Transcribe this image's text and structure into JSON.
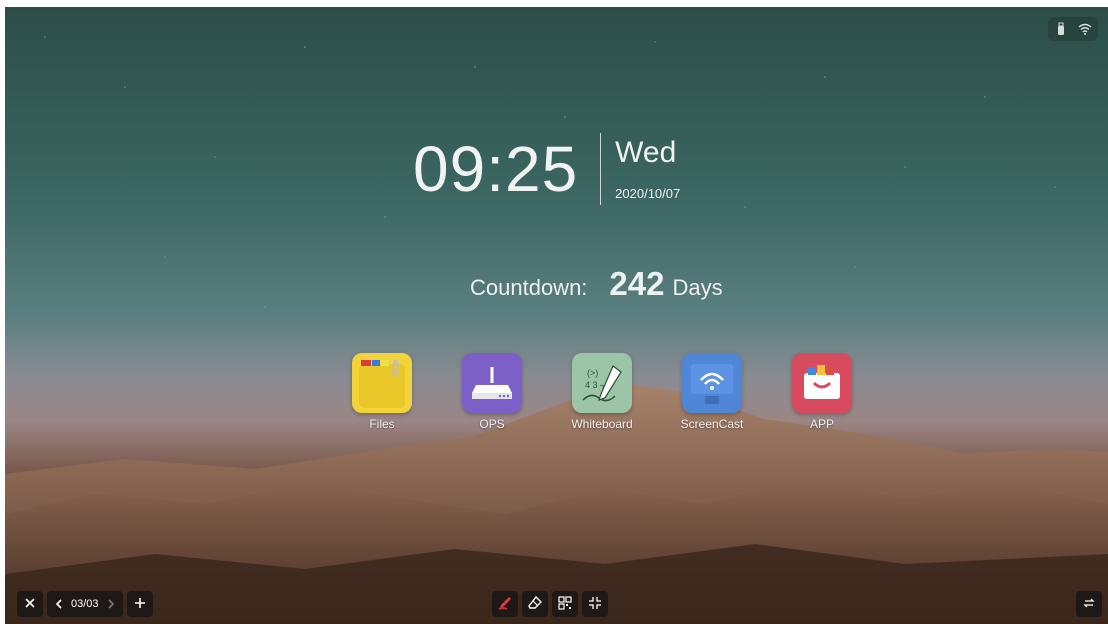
{
  "status_bar": {
    "icons": [
      "usb-icon",
      "wifi-icon"
    ]
  },
  "clock": {
    "time": "09:25",
    "day": "Wed",
    "date": "2020/10/07"
  },
  "countdown": {
    "label": "Countdown:",
    "value": "242",
    "unit": "Days"
  },
  "apps": [
    {
      "label": "Files",
      "icon": "folder-icon",
      "color": "#f2d43a"
    },
    {
      "label": "OPS",
      "icon": "router-icon",
      "color": "#7d5fc8"
    },
    {
      "label": "Whiteboard",
      "icon": "pen-board-icon",
      "color": "#9cc4a6"
    },
    {
      "label": "ScreenCast",
      "icon": "monitor-wifi-icon",
      "color": "#4f86d6"
    },
    {
      "label": "APP",
      "icon": "toolbox-icon",
      "color": "#d84a5e"
    }
  ],
  "bottom_bar": {
    "close_icon": "close-icon",
    "page_indicator": "03/03",
    "add_icon": "plus-icon",
    "tools": [
      "pen-icon",
      "eraser-icon",
      "qr-code-icon",
      "shrink-icon"
    ],
    "switch_icon": "swap-arrows-icon",
    "accent_color": "#e33a3a"
  }
}
